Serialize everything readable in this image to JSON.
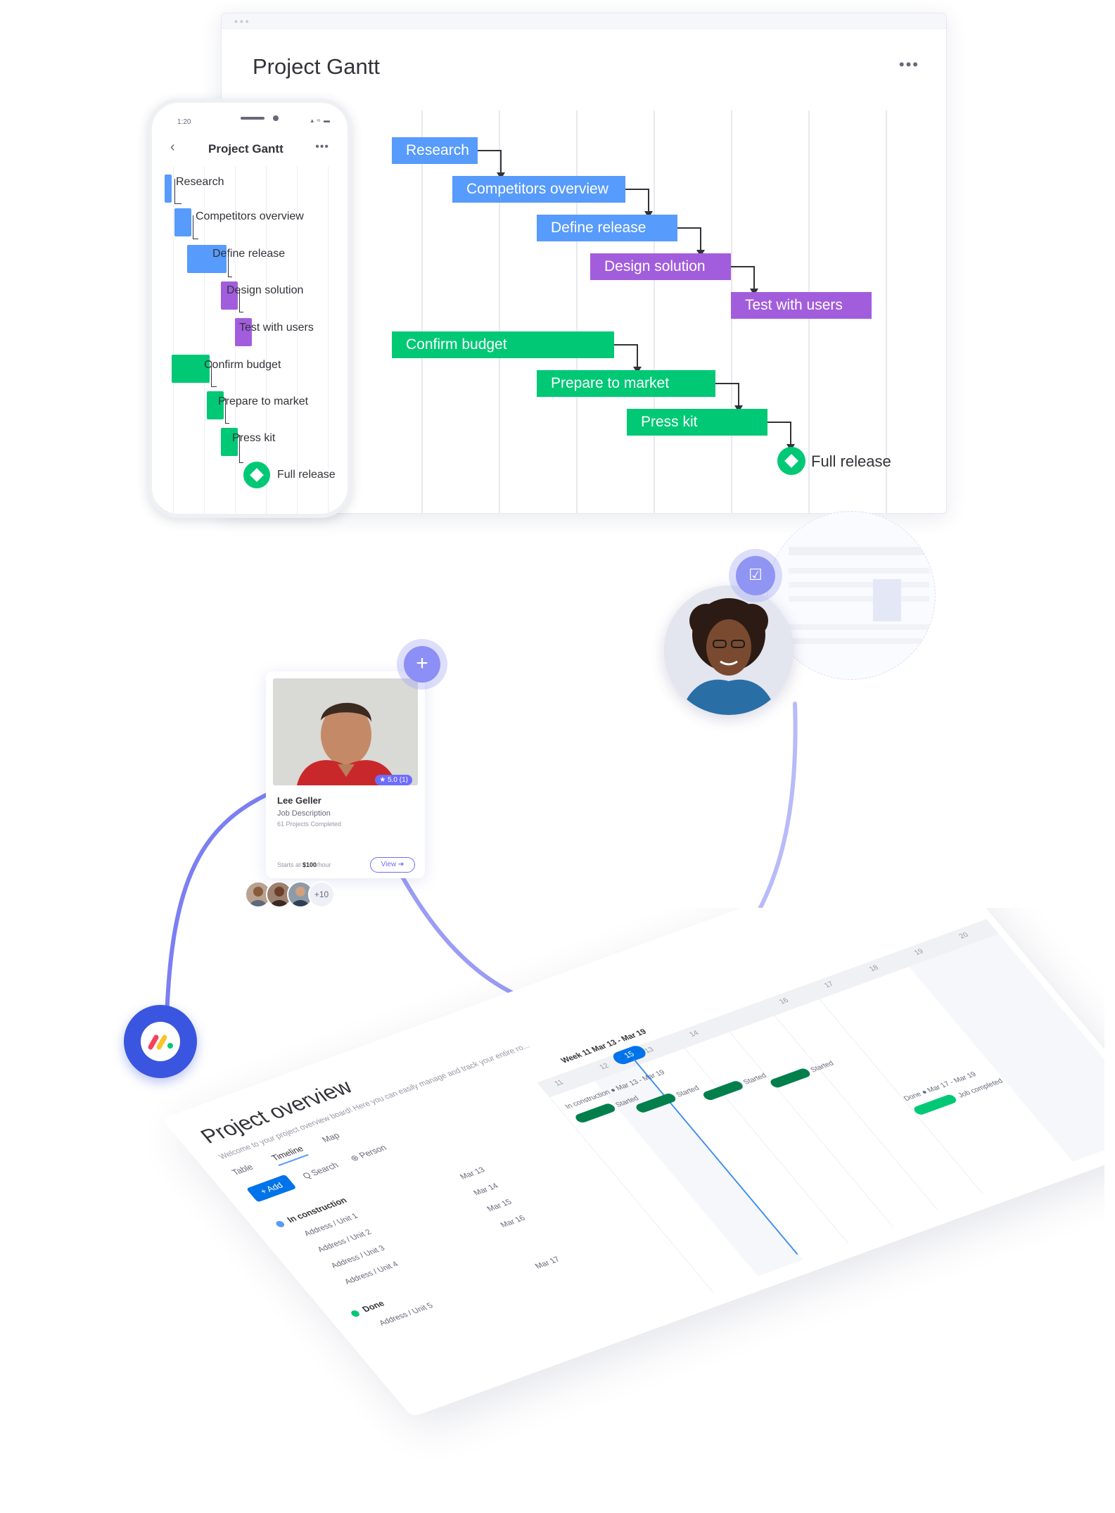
{
  "gantt": {
    "title": "Project Gantt",
    "menu_icon": "more-dots-icon",
    "tasks": [
      {
        "label": "Research",
        "color": "#579bfc"
      },
      {
        "label": "Competitors overview",
        "color": "#579bfc"
      },
      {
        "label": "Define release",
        "color": "#579bfc"
      },
      {
        "label": "Design solution",
        "color": "#a25ddc"
      },
      {
        "label": "Test with users",
        "color": "#a25ddc"
      },
      {
        "label": "Confirm budget",
        "color": "#00c875"
      },
      {
        "label": "Prepare to market",
        "color": "#00c875"
      },
      {
        "label": "Press kit",
        "color": "#00c875"
      }
    ],
    "milestone": {
      "label": "Full release",
      "color": "#00c875"
    }
  },
  "phone": {
    "time": "1:20",
    "status_icons": "▴ ≈ ▬",
    "back_icon": "chevron-left-icon",
    "back_glyph": "‹",
    "title": "Project Gantt",
    "menu_glyph": "•••",
    "tasks": [
      "Research",
      "Competitors overview",
      "Define release",
      "Design solution",
      "Test with users",
      "Confirm budget",
      "Prepare to market",
      "Press kit"
    ],
    "milestone": "Full release"
  },
  "profile_card": {
    "name": "Lee Geller",
    "job": "Job Description",
    "projects": "61 Projects Completed",
    "rating": "★ 5.0 (1)",
    "price_prefix": "Starts at ",
    "price": "$100",
    "price_suffix": "/hour",
    "view_button": "View ➔",
    "extra_count": "+10"
  },
  "actions": {
    "add_glyph": "+",
    "like_glyph": "👍",
    "calendar_glyph": "☑"
  },
  "board": {
    "title": "Project overview",
    "description": "Welcome to your project overview board! Here you can easily manage and track your entire ro...",
    "tabs": [
      "Table",
      "Timeline",
      "Map"
    ],
    "toolbar": {
      "add": "+ Add",
      "search": "Q Search",
      "person": "⊛ Person"
    },
    "week_label": "Week 11 Mar 13 - Mar 19",
    "today": "15",
    "days": [
      "11",
      "12",
      "13",
      "14",
      "15",
      "16",
      "17",
      "18",
      "19",
      "20"
    ],
    "groups": [
      {
        "label": "In construction",
        "color": "#579bfc",
        "rows": [
          {
            "name": "Address / Unit 1",
            "date": "Mar 13"
          },
          {
            "name": "Address / Unit 2",
            "date": "Mar 14"
          },
          {
            "name": "Address / Unit 3",
            "date": "Mar 15"
          },
          {
            "name": "Address / Unit 4",
            "date": "Mar 16"
          }
        ]
      },
      {
        "label": "Done",
        "color": "#00c875",
        "rows": [
          {
            "name": "Address / Unit 5",
            "date": "Mar 17"
          }
        ]
      }
    ],
    "timeline_labels": [
      "In construction ● Mar 13 - Mar 19",
      "Started",
      "Started",
      "Started",
      "Started",
      "Done ● Mar 17 - Mar 19",
      "Job completed"
    ],
    "colors": {
      "accent": "#0073ea",
      "bar": "#037f4c",
      "done_bar": "#00c875"
    }
  }
}
